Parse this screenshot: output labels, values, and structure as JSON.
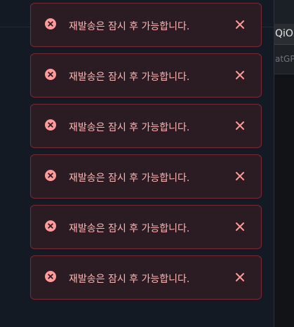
{
  "background_panel": {
    "tab_text": "QiOi",
    "sub_text": "atGP"
  },
  "toasts": [
    {
      "message": "재발송은 잠시 후 가능합니다.",
      "icon": "error-circle-icon",
      "close_icon": "close-icon"
    },
    {
      "message": "재발송은 잠시 후 가능합니다.",
      "icon": "error-circle-icon",
      "close_icon": "close-icon"
    },
    {
      "message": "재발송은 잠시 후 가능합니다.",
      "icon": "error-circle-icon",
      "close_icon": "close-icon"
    },
    {
      "message": "재발송은 잠시 후 가능합니다.",
      "icon": "error-circle-icon",
      "close_icon": "close-icon"
    },
    {
      "message": "재발송은 잠시 후 가능합니다.",
      "icon": "error-circle-icon",
      "close_icon": "close-icon"
    },
    {
      "message": "재발송은 잠시 후 가능합니다.",
      "icon": "error-circle-icon",
      "close_icon": "close-icon"
    }
  ],
  "colors": {
    "toast_background": "#2a1c22",
    "toast_border": "#7a2a33",
    "toast_text": "#ffb6b6",
    "icon": "#ff9a9a",
    "page_background": "#141a24"
  }
}
